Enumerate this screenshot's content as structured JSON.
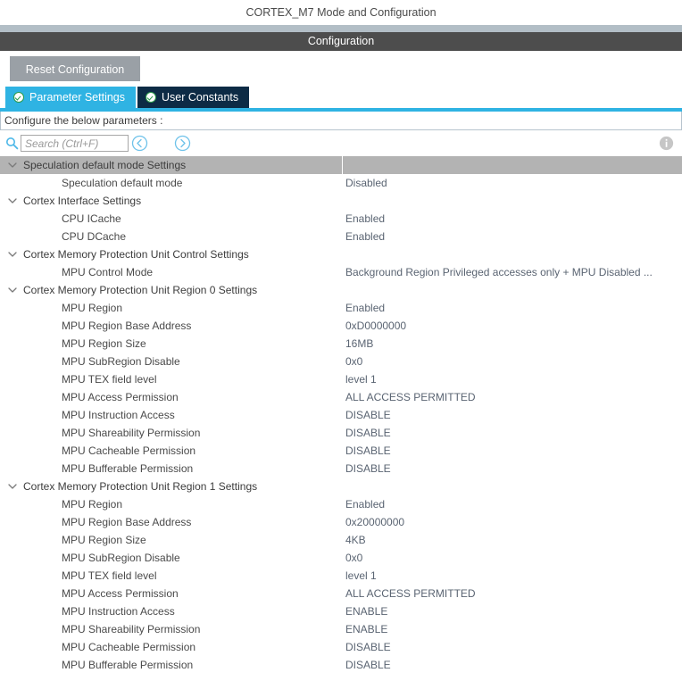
{
  "window": {
    "title": "CORTEX_M7 Mode and Configuration",
    "section_bar": "Configuration"
  },
  "toolbar": {
    "reset_label": "Reset Configuration"
  },
  "tabs": [
    {
      "label": "Parameter Settings",
      "active": true,
      "icon": "check-circle-icon"
    },
    {
      "label": "User Constants",
      "active": false,
      "icon": "check-circle-icon"
    }
  ],
  "configure_label": "Configure the below parameters :",
  "search": {
    "placeholder": "Search (Ctrl+F)",
    "value": "",
    "icon": "search-icon",
    "prev_icon": "chevron-left-circle-icon",
    "next_icon": "chevron-right-circle-icon",
    "info_icon": "info-icon"
  },
  "colors": {
    "accent": "#2fb3e3",
    "tab_inactive": "#0d2b45",
    "section_bar": "#4d4d4d",
    "group_row": "#b3b3b3",
    "button": "#9aa0a6",
    "value_text": "#5a6472"
  },
  "tree": [
    {
      "type": "group",
      "label": "Speculation default mode Settings",
      "expanded": true,
      "highlight": true
    },
    {
      "type": "child",
      "label": "Speculation default mode",
      "value": "Disabled"
    },
    {
      "type": "group",
      "label": "Cortex Interface Settings",
      "expanded": true,
      "highlight": false
    },
    {
      "type": "child",
      "label": "CPU ICache",
      "value": "Enabled"
    },
    {
      "type": "child",
      "label": "CPU DCache",
      "value": "Enabled"
    },
    {
      "type": "group",
      "label": "Cortex Memory Protection Unit Control Settings",
      "expanded": true,
      "highlight": false
    },
    {
      "type": "child",
      "label": "MPU Control Mode",
      "value": "Background Region Privileged accesses only + MPU Disabled ..."
    },
    {
      "type": "group",
      "label": "Cortex Memory Protection Unit Region 0 Settings",
      "expanded": true,
      "highlight": false
    },
    {
      "type": "child",
      "label": "MPU Region",
      "value": "Enabled"
    },
    {
      "type": "child",
      "label": "MPU Region Base Address",
      "value": "0xD0000000"
    },
    {
      "type": "child",
      "label": "MPU Region Size",
      "value": "16MB"
    },
    {
      "type": "child",
      "label": "MPU SubRegion Disable",
      "value": "0x0"
    },
    {
      "type": "child",
      "label": "MPU TEX field level",
      "value": "level 1"
    },
    {
      "type": "child",
      "label": "MPU Access Permission",
      "value": "ALL ACCESS PERMITTED"
    },
    {
      "type": "child",
      "label": "MPU Instruction Access",
      "value": "DISABLE"
    },
    {
      "type": "child",
      "label": "MPU Shareability Permission",
      "value": "DISABLE"
    },
    {
      "type": "child",
      "label": "MPU Cacheable Permission",
      "value": "DISABLE"
    },
    {
      "type": "child",
      "label": "MPU Bufferable  Permission",
      "value": "DISABLE"
    },
    {
      "type": "group",
      "label": "Cortex Memory Protection Unit Region 1 Settings",
      "expanded": true,
      "highlight": false
    },
    {
      "type": "child",
      "label": "MPU Region",
      "value": "Enabled"
    },
    {
      "type": "child",
      "label": "MPU Region Base Address",
      "value": "0x20000000"
    },
    {
      "type": "child",
      "label": "MPU Region Size",
      "value": "4KB"
    },
    {
      "type": "child",
      "label": "MPU SubRegion Disable",
      "value": "0x0"
    },
    {
      "type": "child",
      "label": "MPU TEX field level",
      "value": "level 1"
    },
    {
      "type": "child",
      "label": "MPU Access Permission",
      "value": "ALL ACCESS PERMITTED"
    },
    {
      "type": "child",
      "label": "MPU Instruction Access",
      "value": "ENABLE"
    },
    {
      "type": "child",
      "label": "MPU Shareability Permission",
      "value": "ENABLE"
    },
    {
      "type": "child",
      "label": "MPU Cacheable Permission",
      "value": "DISABLE"
    },
    {
      "type": "child",
      "label": "MPU Bufferable  Permission",
      "value": "DISABLE"
    }
  ]
}
